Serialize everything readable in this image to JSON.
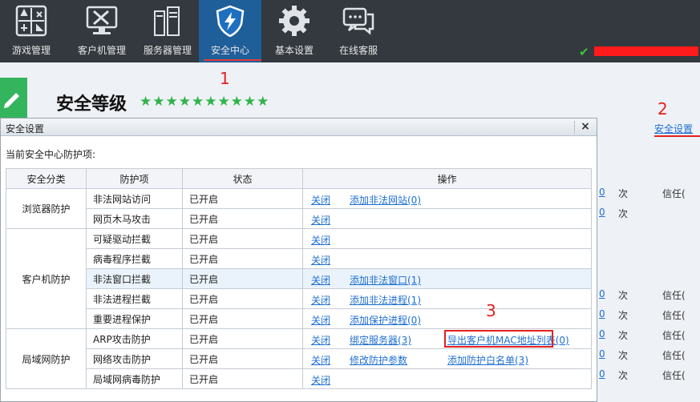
{
  "nav": [
    {
      "label": "游戏管理",
      "icon": "games-icon"
    },
    {
      "label": "客户机管理",
      "icon": "client-monitor-icon"
    },
    {
      "label": "服务器管理",
      "icon": "server-icon"
    },
    {
      "label": "安全中心",
      "icon": "shield-bolt-icon",
      "active": true
    },
    {
      "label": "基本设置",
      "icon": "gear-icon"
    },
    {
      "label": "在线客服",
      "icon": "chat-icon"
    }
  ],
  "annotations": {
    "n1": "1",
    "n2": "2",
    "n3": "3"
  },
  "page": {
    "title": "安全等级",
    "stars": "★★★★★★★★★★",
    "settings_link": "安全设置",
    "bg_rows": [
      {
        "num": "0",
        "unit": "次",
        "trust": "信任("
      },
      {
        "num": "0",
        "unit": "次",
        "trust": ""
      },
      {
        "num": "0",
        "unit": "次",
        "trust": "信任("
      },
      {
        "num": "0",
        "unit": "次",
        "trust": "信任("
      },
      {
        "num": "0",
        "unit": "次",
        "trust": "信任("
      },
      {
        "num": "0",
        "unit": "次",
        "trust": "信任("
      },
      {
        "num": "0",
        "unit": "次",
        "trust": "信任("
      },
      {
        "num": "0",
        "unit": "次",
        "trust": ""
      }
    ]
  },
  "dialog": {
    "title": "安全设置",
    "close": "×",
    "subtitle": "当前安全中心防护项:",
    "headers": [
      "安全分类",
      "防护项",
      "状态",
      "操作"
    ],
    "groups": [
      {
        "category": "浏览器防护",
        "rows": [
          {
            "item": "非法网站访问",
            "status": "已开启",
            "ops": [
              "关闭",
              "添加非法网站(0)"
            ]
          },
          {
            "item": "网页木马攻击",
            "status": "已开启",
            "ops": [
              "关闭"
            ]
          }
        ]
      },
      {
        "category": "客户机防护",
        "rows": [
          {
            "item": "可疑驱动拦截",
            "status": "已开启",
            "ops": [
              "关闭"
            ]
          },
          {
            "item": "病毒程序拦截",
            "status": "已开启",
            "ops": [
              "关闭"
            ]
          },
          {
            "item": "非法窗口拦截",
            "status": "已开启",
            "ops": [
              "关闭",
              "添加非法窗口(1)"
            ],
            "highlight": true
          },
          {
            "item": "非法进程拦截",
            "status": "已开启",
            "ops": [
              "关闭",
              "添加非法进程(1)"
            ]
          },
          {
            "item": "重要进程保护",
            "status": "已开启",
            "ops": [
              "关闭",
              "添加保护进程(0)"
            ]
          }
        ]
      },
      {
        "category": "局域网防护",
        "rows": [
          {
            "item": "ARP攻击防护",
            "status": "已开启",
            "ops": [
              "关闭",
              "绑定服务器(3)",
              "导出客户机MAC地址列表(0)"
            ]
          },
          {
            "item": "网络攻击防护",
            "status": "已开启",
            "ops": [
              "关闭",
              "修改防护参数",
              "添加防护白名单(3)"
            ]
          },
          {
            "item": "局域网病毒防护",
            "status": "已开启",
            "ops": [
              "关闭"
            ]
          }
        ]
      }
    ]
  },
  "colors": {
    "nav_bg": "#33393f",
    "nav_active": "#1f5f99",
    "link": "#1f6fd1",
    "annotation": "#e32020",
    "star": "#2fb34a"
  }
}
